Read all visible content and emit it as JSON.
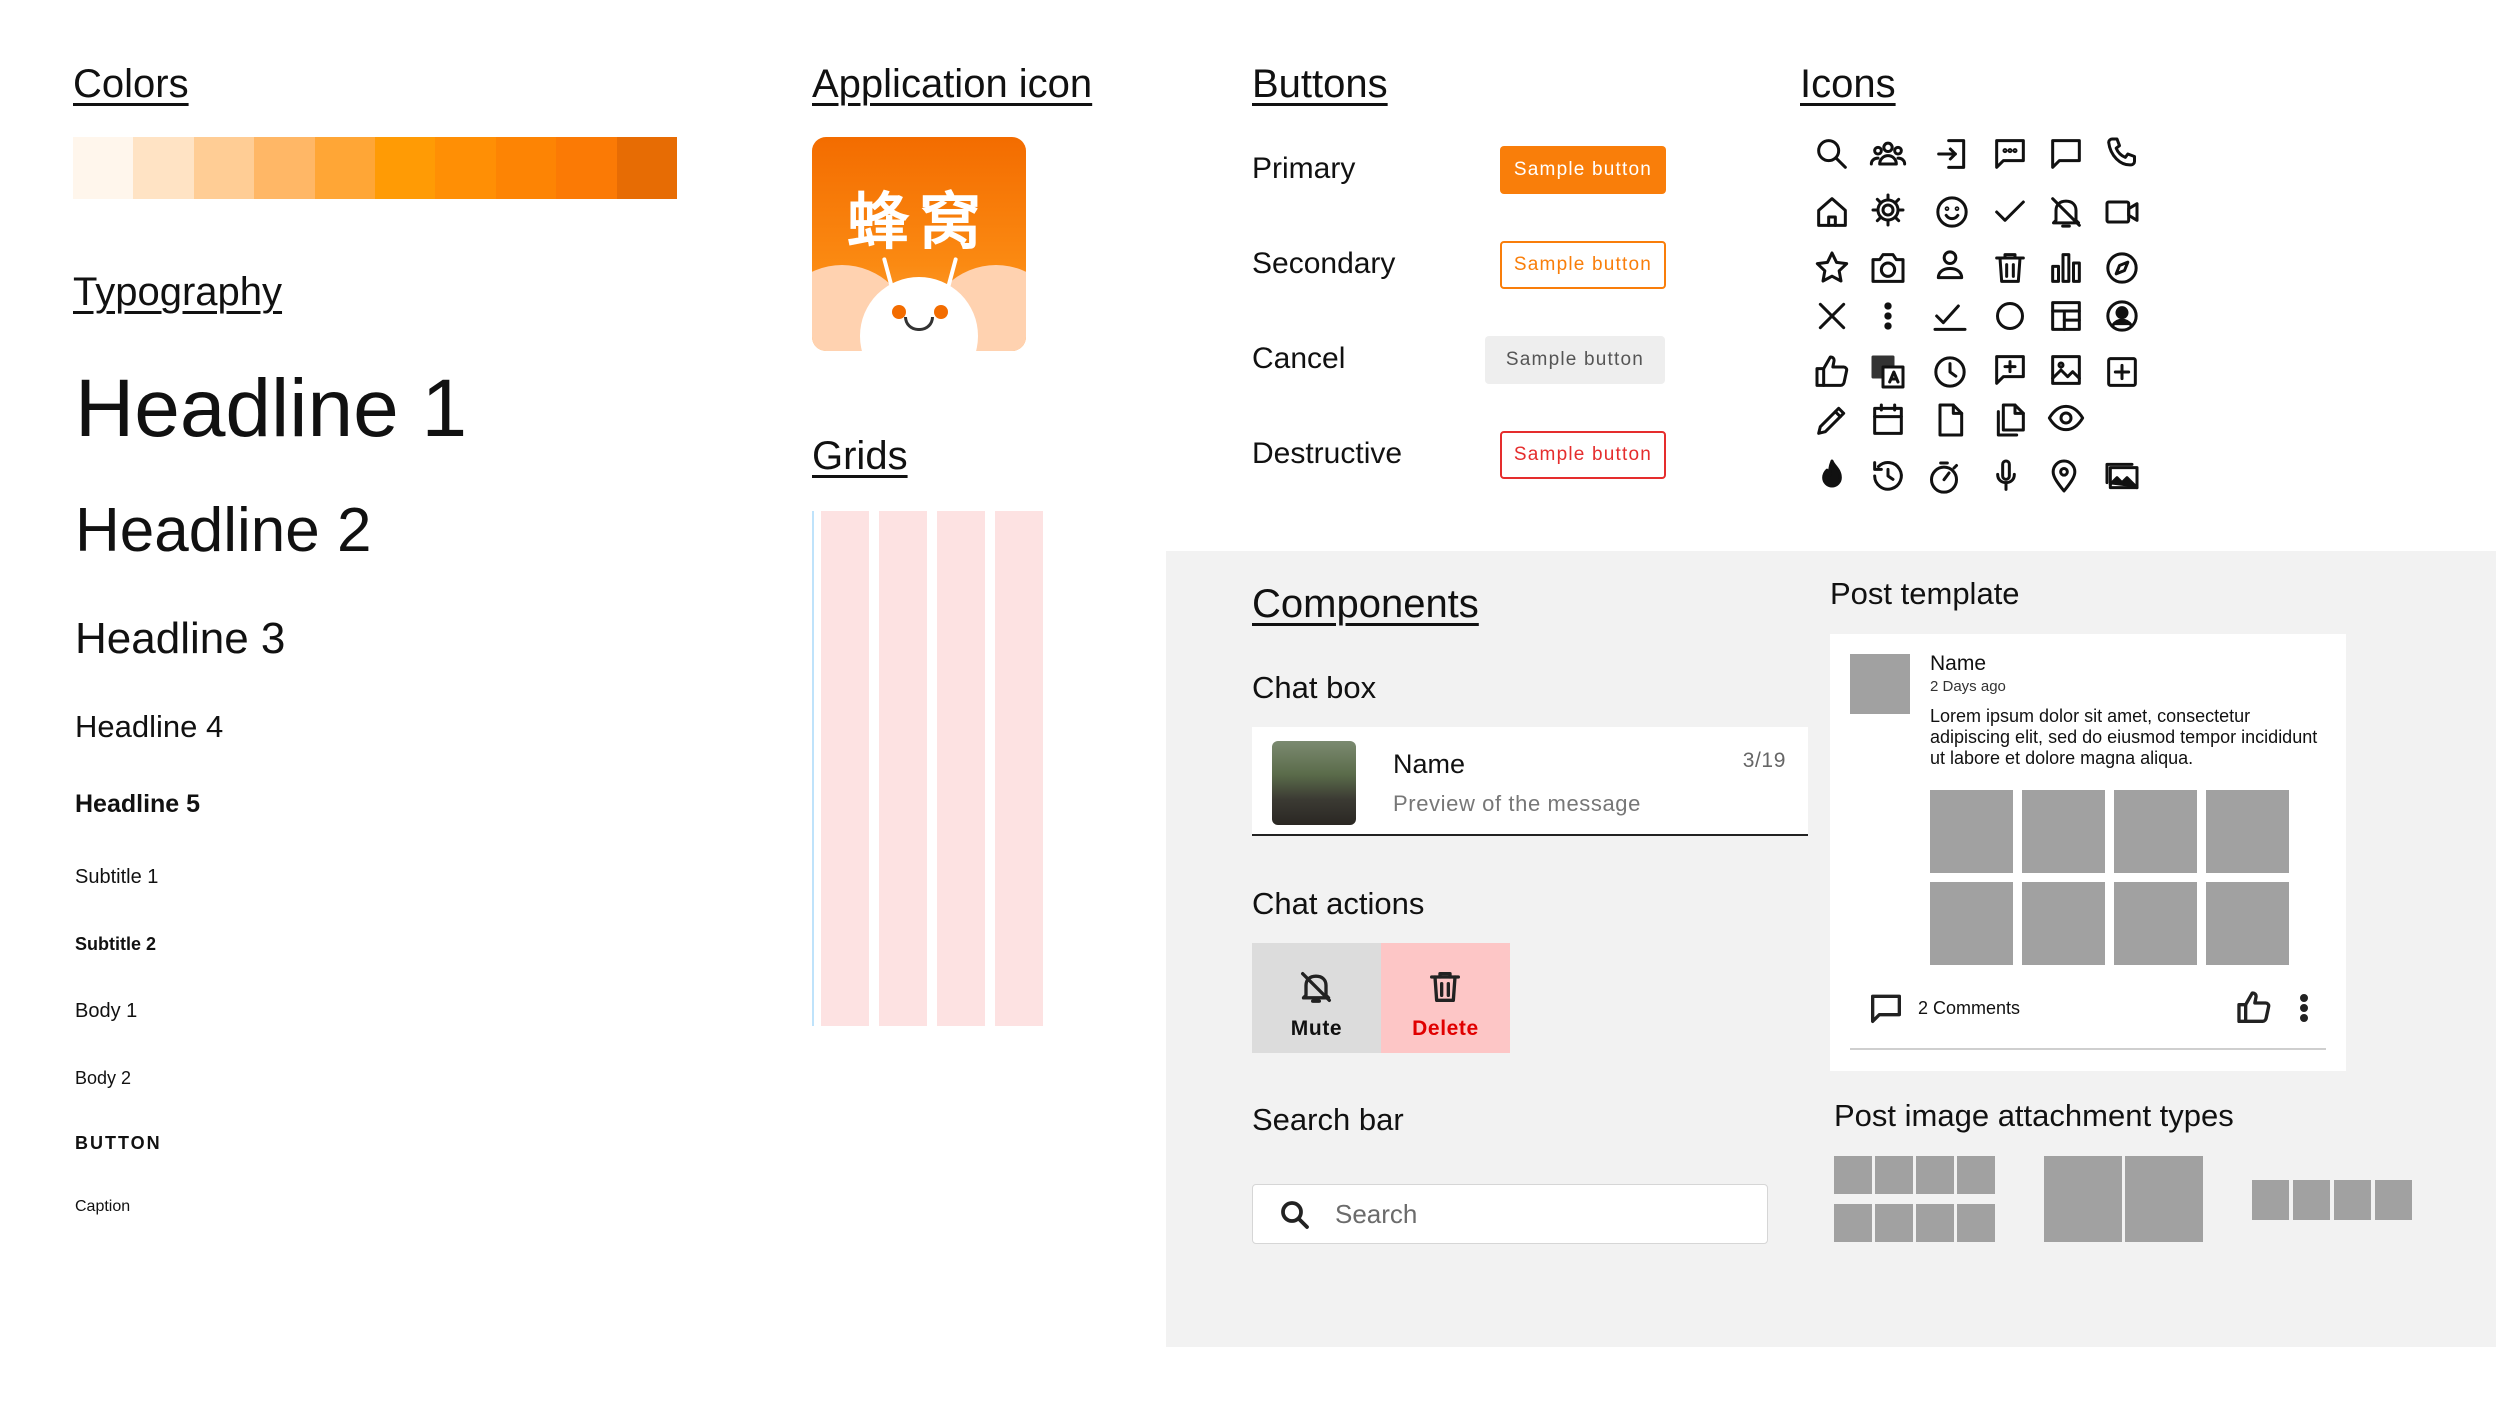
{
  "sections": {
    "colors": "Colors",
    "typography": "Typography",
    "app_icon": "Application icon",
    "grids": "Grids",
    "buttons": "Buttons",
    "icons": "Icons",
    "components": "Components"
  },
  "palette": [
    "#fff6ec",
    "#ffe3c4",
    "#ffcd95",
    "#ffb766",
    "#ffa636",
    "#ff9b05",
    "#ff8f05",
    "#fd8404",
    "#fb7a05",
    "#e76c04"
  ],
  "typography": {
    "h1": "Headline 1",
    "h2": "Headline 2",
    "h3": "Headline 3",
    "h4": "Headline 4",
    "h5": "Headline 5",
    "subtitle1": "Subtitle 1",
    "subtitle2": "Subtitle 2",
    "body1": "Body 1",
    "body2": "Body 2",
    "button": "BUTTON",
    "caption": "Caption"
  },
  "app_icon": {
    "text": "蜂窝",
    "colors": {
      "top": "#f36c00",
      "bottom": "#fdab4a",
      "wing": "#ffd2b0"
    }
  },
  "buttons": {
    "primary_label": "Primary",
    "secondary_label": "Secondary",
    "cancel_label": "Cancel",
    "destructive_label": "Destructive",
    "sample": "Sample button",
    "colors": {
      "accent": "#f97e0a",
      "destructive": "#e52d2d",
      "cancel_bg": "#eeeeee"
    }
  },
  "icons": [
    [
      "search-icon",
      "group-icon",
      "login-icon",
      "chat-dots-icon",
      "chat-bubble-icon",
      "phone-icon"
    ],
    [
      "home-icon",
      "gear-icon",
      "smiley-icon",
      "check-icon",
      "bell-off-icon",
      "video-icon"
    ],
    [
      "star-icon",
      "camera-icon",
      "person-icon",
      "trash-icon",
      "bar-chart-icon",
      "compass-icon"
    ],
    [
      "close-icon",
      "more-vertical-icon",
      "checklist-icon",
      "circle-icon",
      "layout-icon",
      "account-circle-icon"
    ],
    [
      "thumb-up-icon",
      "translate-icon",
      "clock-icon",
      "add-comment-icon",
      "image-icon",
      "add-box-icon"
    ],
    [
      "pencil-icon",
      "calendar-icon",
      "file-icon",
      "copy-icon",
      "eye-icon"
    ],
    [
      "fire-icon",
      "history-icon",
      "timer-icon",
      "mic-icon",
      "location-icon",
      "photo-album-icon"
    ]
  ],
  "components": {
    "chat_box_title": "Chat box",
    "chat": {
      "name": "Name",
      "preview": "Preview of the message",
      "count": "3/19"
    },
    "chat_actions_title": "Chat actions",
    "actions": {
      "mute": "Mute",
      "delete": "Delete",
      "delete_color": "#e00000"
    },
    "search_bar_title": "Search bar",
    "search": {
      "placeholder": "Search"
    },
    "post_template_title": "Post template",
    "post": {
      "name": "Name",
      "date": "2 Days ago",
      "body": "Lorem ipsum dolor sit amet, consectetur adipiscing elit, sed do eiusmod tempor incididunt ut labore et dolore magna aliqua.",
      "comments": "2 Comments"
    },
    "attachment_title": "Post image attachment types",
    "placeholder_color": "#a1a1a1"
  }
}
